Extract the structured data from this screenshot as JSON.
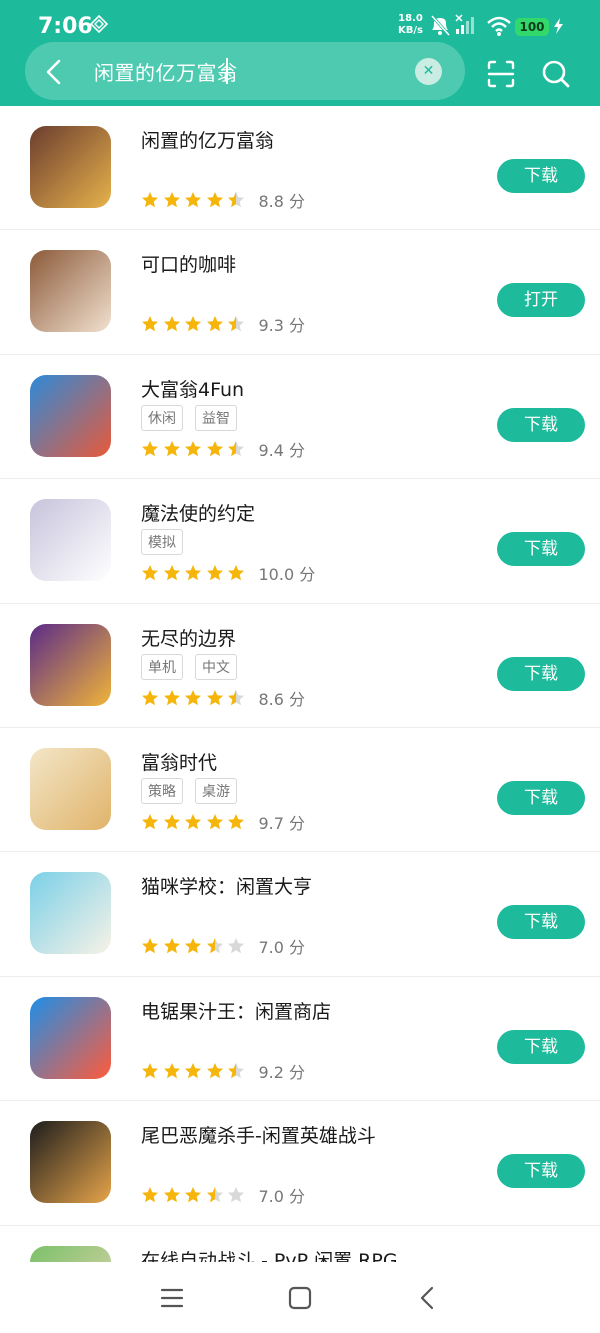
{
  "status_bar": {
    "time": "7:06",
    "net_speed_value": "18.0",
    "net_speed_unit": "KB/s",
    "battery": "100"
  },
  "search": {
    "query": "闲置的亿万富翁"
  },
  "apps": [
    {
      "name": "闲置的亿万富翁",
      "tags": [],
      "stars": [
        1,
        1,
        1,
        1,
        0.5
      ],
      "score": "8.8 分",
      "button": "下载",
      "colors": [
        "#6b3d2e",
        "#e7b24c"
      ]
    },
    {
      "name": "可口的咖啡",
      "tags": [],
      "stars": [
        1,
        1,
        1,
        1,
        0.5
      ],
      "score": "9.3 分",
      "button": "打开",
      "colors": [
        "#8c5a3a",
        "#f1e1cf"
      ]
    },
    {
      "name": "大富翁4Fun",
      "tags": [
        "休闲",
        "益智"
      ],
      "stars": [
        1,
        1,
        1,
        1,
        0.5
      ],
      "score": "9.4 分",
      "button": "下载",
      "colors": [
        "#2d8ad8",
        "#e85a3a"
      ]
    },
    {
      "name": "魔法使的约定",
      "tags": [
        "模拟"
      ],
      "stars": [
        1,
        1,
        1,
        1,
        1
      ],
      "score": "10.0 分",
      "button": "下载",
      "colors": [
        "#c7c3dc",
        "#ffffff"
      ]
    },
    {
      "name": "无尽的边界",
      "tags": [
        "单机",
        "中文"
      ],
      "stars": [
        1,
        1,
        1,
        1,
        0.5
      ],
      "score": "8.6 分",
      "button": "下载",
      "colors": [
        "#5b2b88",
        "#f0b43a"
      ]
    },
    {
      "name": "富翁时代",
      "tags": [
        "策略",
        "桌游"
      ],
      "stars": [
        1,
        1,
        1,
        1,
        1
      ],
      "score": "9.7 分",
      "button": "下载",
      "colors": [
        "#f3e6c7",
        "#e0b36a"
      ]
    },
    {
      "name": "猫咪学校：闲置大亨",
      "tags": [],
      "stars": [
        1,
        1,
        1,
        0.5,
        0
      ],
      "score": "7.0 分",
      "button": "下载",
      "colors": [
        "#7bd0e8",
        "#f7f2e6"
      ]
    },
    {
      "name": "电锯果汁王：闲置商店",
      "tags": [],
      "stars": [
        1,
        1,
        1,
        1,
        0.5
      ],
      "score": "9.2 分",
      "button": "下载",
      "colors": [
        "#1e8ee8",
        "#ff5b3a"
      ]
    },
    {
      "name": "尾巴恶魔杀手-闲置英雄战斗",
      "tags": [],
      "stars": [
        1,
        1,
        1,
        0.5,
        0
      ],
      "score": "7.0 分",
      "button": "下载",
      "colors": [
        "#1d1d1d",
        "#e6a44a"
      ]
    }
  ],
  "partial_app": {
    "name": "在线自动战斗 - PvP 闲置 RPG",
    "colors": [
      "#7bc06a",
      "#e6d6b0"
    ]
  },
  "theme": {
    "accent": "#1dbb9b",
    "star_active": "#f5b50a",
    "star_inactive": "#d9d9d9"
  }
}
